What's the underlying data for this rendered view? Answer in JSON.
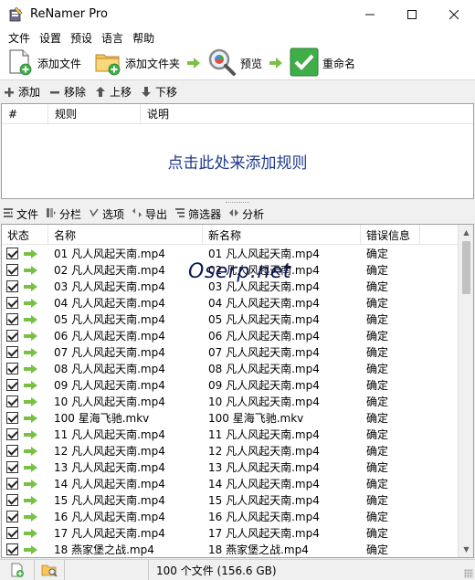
{
  "window": {
    "title": "ReNamer Pro",
    "minimize": "—",
    "maximize": "☐",
    "close": "✕"
  },
  "menu": [
    "文件",
    "设置",
    "预设",
    "语言",
    "帮助"
  ],
  "toolbar": {
    "add_files": "添加文件",
    "add_folder": "添加文件夹",
    "preview": "预览",
    "rename": "重命名"
  },
  "rules_toolbar": {
    "add": "添加",
    "remove": "移除",
    "up": "上移",
    "down": "下移"
  },
  "rules_table": {
    "columns": [
      "#",
      "规则",
      "说明"
    ],
    "empty_hint": "点击此处来添加规则"
  },
  "files_toolbar": {
    "file": "文件",
    "columns": "分栏",
    "options": "选项",
    "export": "导出",
    "filter": "筛选器",
    "analyze": "分析"
  },
  "files_table": {
    "columns": [
      "状态",
      "名称",
      "新名称",
      "错误信息"
    ],
    "rows": [
      {
        "name": "01 凡人风起天南.mp4",
        "new_name": "01 凡人风起天南.mp4",
        "error": "确定"
      },
      {
        "name": "02 凡人风起天南.mp4",
        "new_name": "02 凡人风起天南.mp4",
        "error": "确定"
      },
      {
        "name": "03 凡人风起天南.mp4",
        "new_name": "03 凡人风起天南.mp4",
        "error": "确定"
      },
      {
        "name": "04 凡人风起天南.mp4",
        "new_name": "04 凡人风起天南.mp4",
        "error": "确定"
      },
      {
        "name": "05 凡人风起天南.mp4",
        "new_name": "05 凡人风起天南.mp4",
        "error": "确定"
      },
      {
        "name": "06 凡人风起天南.mp4",
        "new_name": "06 凡人风起天南.mp4",
        "error": "确定"
      },
      {
        "name": "07 凡人风起天南.mp4",
        "new_name": "07 凡人风起天南.mp4",
        "error": "确定"
      },
      {
        "name": "08 凡人风起天南.mp4",
        "new_name": "08 凡人风起天南.mp4",
        "error": "确定"
      },
      {
        "name": "09 凡人风起天南.mp4",
        "new_name": "09 凡人风起天南.mp4",
        "error": "确定"
      },
      {
        "name": "10 凡人风起天南.mp4",
        "new_name": "10 凡人风起天南.mp4",
        "error": "确定"
      },
      {
        "name": "100 星海飞驰.mkv",
        "new_name": "100 星海飞驰.mkv",
        "error": "确定"
      },
      {
        "name": "11 凡人风起天南.mp4",
        "new_name": "11 凡人风起天南.mp4",
        "error": "确定"
      },
      {
        "name": "12 凡人风起天南.mp4",
        "new_name": "12 凡人风起天南.mp4",
        "error": "确定"
      },
      {
        "name": "13 凡人风起天南.mp4",
        "new_name": "13 凡人风起天南.mp4",
        "error": "确定"
      },
      {
        "name": "14 凡人风起天南.mp4",
        "new_name": "14 凡人风起天南.mp4",
        "error": "确定"
      },
      {
        "name": "15 凡人风起天南.mp4",
        "new_name": "15 凡人风起天南.mp4",
        "error": "确定"
      },
      {
        "name": "16 凡人风起天南.mp4",
        "new_name": "16 凡人风起天南.mp4",
        "error": "确定"
      },
      {
        "name": "17 凡人风起天南.mp4",
        "new_name": "17 凡人风起天南.mp4",
        "error": "确定"
      },
      {
        "name": "18 燕家堡之战.mp4",
        "new_name": "18 燕家堡之战.mp4",
        "error": "确定"
      }
    ]
  },
  "watermark": "Oserp.net",
  "status": {
    "summary": "100 个文件 (156.6 GB)"
  },
  "colors": {
    "hint_blue": "#1f3a8c",
    "green_arrow": "#7ac143",
    "rename_green": "#3fae49"
  }
}
